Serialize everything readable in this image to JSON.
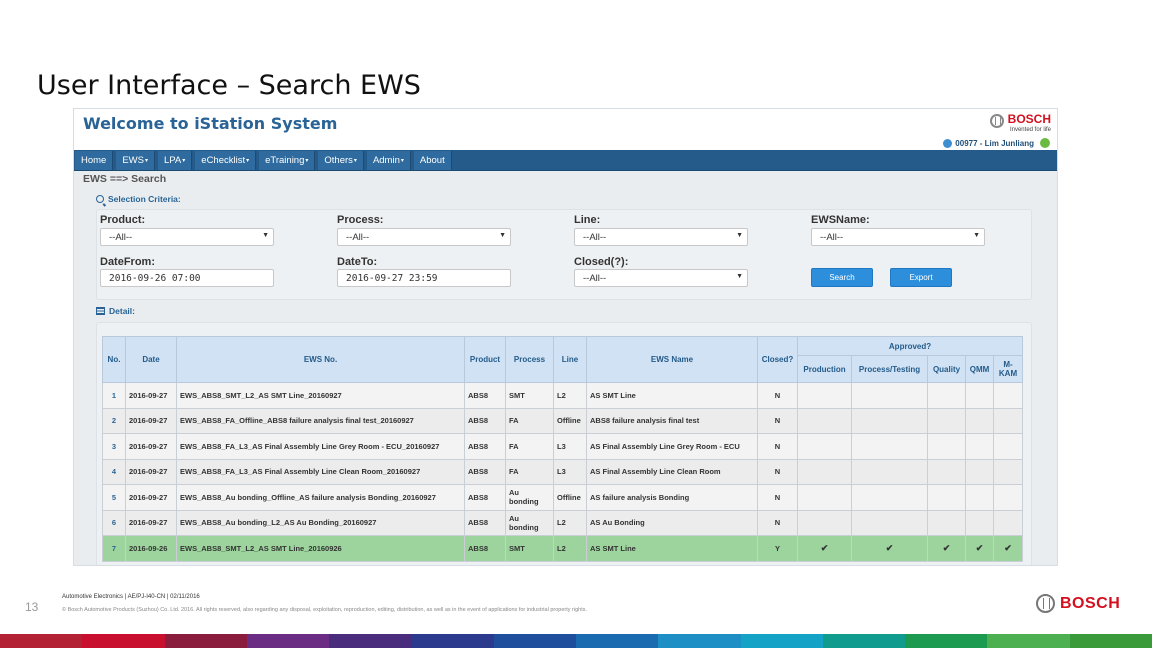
{
  "slide": {
    "title": "User Interface – Search EWS",
    "page_number": "13",
    "footer_line1": "Automotive Electronics | AE/PJ-I40-CN | 02/11/2016",
    "footer_line2": "© Bosch Automotive Products (Suzhou) Co. Ltd. 2016. All rights reserved, also regarding any disposal, exploitation, reproduction, editing, distribution, as well as in the event of applications for industrial property rights.",
    "footer_brand": "BOSCH",
    "strip_colors": [
      "#b22234",
      "#c8102e",
      "#8a1c3d",
      "#6b2d84",
      "#4a2c7c",
      "#2b3a8c",
      "#1f4e9c",
      "#1a6bb0",
      "#1d8fc4",
      "#14a3c7",
      "#0f9b8e",
      "#1c9a4f",
      "#4caf50",
      "#3a9a3a"
    ]
  },
  "app": {
    "title": "Welcome to iStation System",
    "brand_name": "BOSCH",
    "brand_tagline": "Invented for life",
    "user": "00977 - Lim Junliang",
    "breadcrumb": "EWS ==> Search",
    "nav": [
      {
        "label": "Home",
        "caret": ""
      },
      {
        "label": "EWS",
        "caret": "▾"
      },
      {
        "label": "LPA",
        "caret": "▾"
      },
      {
        "label": "eChecklist",
        "caret": "▾"
      },
      {
        "label": "eTraining",
        "caret": "▾"
      },
      {
        "label": "Others",
        "caret": "▾"
      },
      {
        "label": "Admin",
        "caret": "▾"
      },
      {
        "label": "About",
        "caret": ""
      }
    ]
  },
  "criteria": {
    "section_label": "Selection Criteria:",
    "product_label": "Product:",
    "product_value": "--All--",
    "process_label": "Process:",
    "process_value": "--All--",
    "line_label": "Line:",
    "line_value": "--All--",
    "ewsname_label": "EWSName:",
    "ewsname_value": "--All--",
    "datefrom_label": "DateFrom:",
    "datefrom_value": "2016-09-26 07:00",
    "dateto_label": "DateTo:",
    "dateto_value": "2016-09-27 23:59",
    "closed_label": "Closed(?):",
    "closed_value": "--All--",
    "search_button": "Search",
    "export_button": "Export"
  },
  "detail": {
    "section_label": "Detail:",
    "headers": {
      "no": "No.",
      "date": "Date",
      "ews_no": "EWS No.",
      "product": "Product",
      "process": "Process",
      "line": "Line",
      "ews_name": "EWS Name",
      "closed": "Closed?",
      "approved": "Approved?",
      "production": "Production",
      "process_testing": "Process/Testing",
      "quality": "Quality",
      "qmm": "QMM",
      "mkam": "M-KAM"
    },
    "rows": [
      {
        "no": "1",
        "date": "2016-09-27",
        "ews_no": "EWS_ABS8_SMT_L2_AS SMT Line_20160927",
        "product": "ABS8",
        "process": "SMT",
        "line": "L2",
        "ews_name": "AS SMT Line",
        "closed": "N",
        "production": "",
        "process_testing": "",
        "quality": "",
        "qmm": "",
        "mkam": ""
      },
      {
        "no": "2",
        "date": "2016-09-27",
        "ews_no": "EWS_ABS8_FA_Offline_ABS8 failure analysis final test_20160927",
        "product": "ABS8",
        "process": "FA",
        "line": "Offline",
        "ews_name": "ABS8 failure analysis final test",
        "closed": "N",
        "production": "",
        "process_testing": "",
        "quality": "",
        "qmm": "",
        "mkam": ""
      },
      {
        "no": "3",
        "date": "2016-09-27",
        "ews_no": "EWS_ABS8_FA_L3_AS Final Assembly Line Grey Room - ECU_20160927",
        "product": "ABS8",
        "process": "FA",
        "line": "L3",
        "ews_name": "AS Final Assembly Line Grey Room - ECU",
        "closed": "N",
        "production": "",
        "process_testing": "",
        "quality": "",
        "qmm": "",
        "mkam": ""
      },
      {
        "no": "4",
        "date": "2016-09-27",
        "ews_no": "EWS_ABS8_FA_L3_AS Final Assembly Line Clean Room_20160927",
        "product": "ABS8",
        "process": "FA",
        "line": "L3",
        "ews_name": "AS Final Assembly Line Clean Room",
        "closed": "N",
        "production": "",
        "process_testing": "",
        "quality": "",
        "qmm": "",
        "mkam": ""
      },
      {
        "no": "5",
        "date": "2016-09-27",
        "ews_no": "EWS_ABS8_Au bonding_Offline_AS failure analysis Bonding_20160927",
        "product": "ABS8",
        "process": "Au bonding",
        "line": "Offline",
        "ews_name": "AS failure analysis Bonding",
        "closed": "N",
        "production": "",
        "process_testing": "",
        "quality": "",
        "qmm": "",
        "mkam": ""
      },
      {
        "no": "6",
        "date": "2016-09-27",
        "ews_no": "EWS_ABS8_Au bonding_L2_AS Au Bonding_20160927",
        "product": "ABS8",
        "process": "Au bonding",
        "line": "L2",
        "ews_name": "AS Au Bonding",
        "closed": "N",
        "production": "",
        "process_testing": "",
        "quality": "",
        "qmm": "",
        "mkam": ""
      },
      {
        "no": "7",
        "date": "2016-09-26",
        "ews_no": "EWS_ABS8_SMT_L2_AS SMT Line_20160926",
        "product": "ABS8",
        "process": "SMT",
        "line": "L2",
        "ews_name": "AS SMT Line",
        "closed": "Y",
        "production": "✔",
        "process_testing": "✔",
        "quality": "✔",
        "qmm": "✔",
        "mkam": "✔"
      }
    ]
  }
}
